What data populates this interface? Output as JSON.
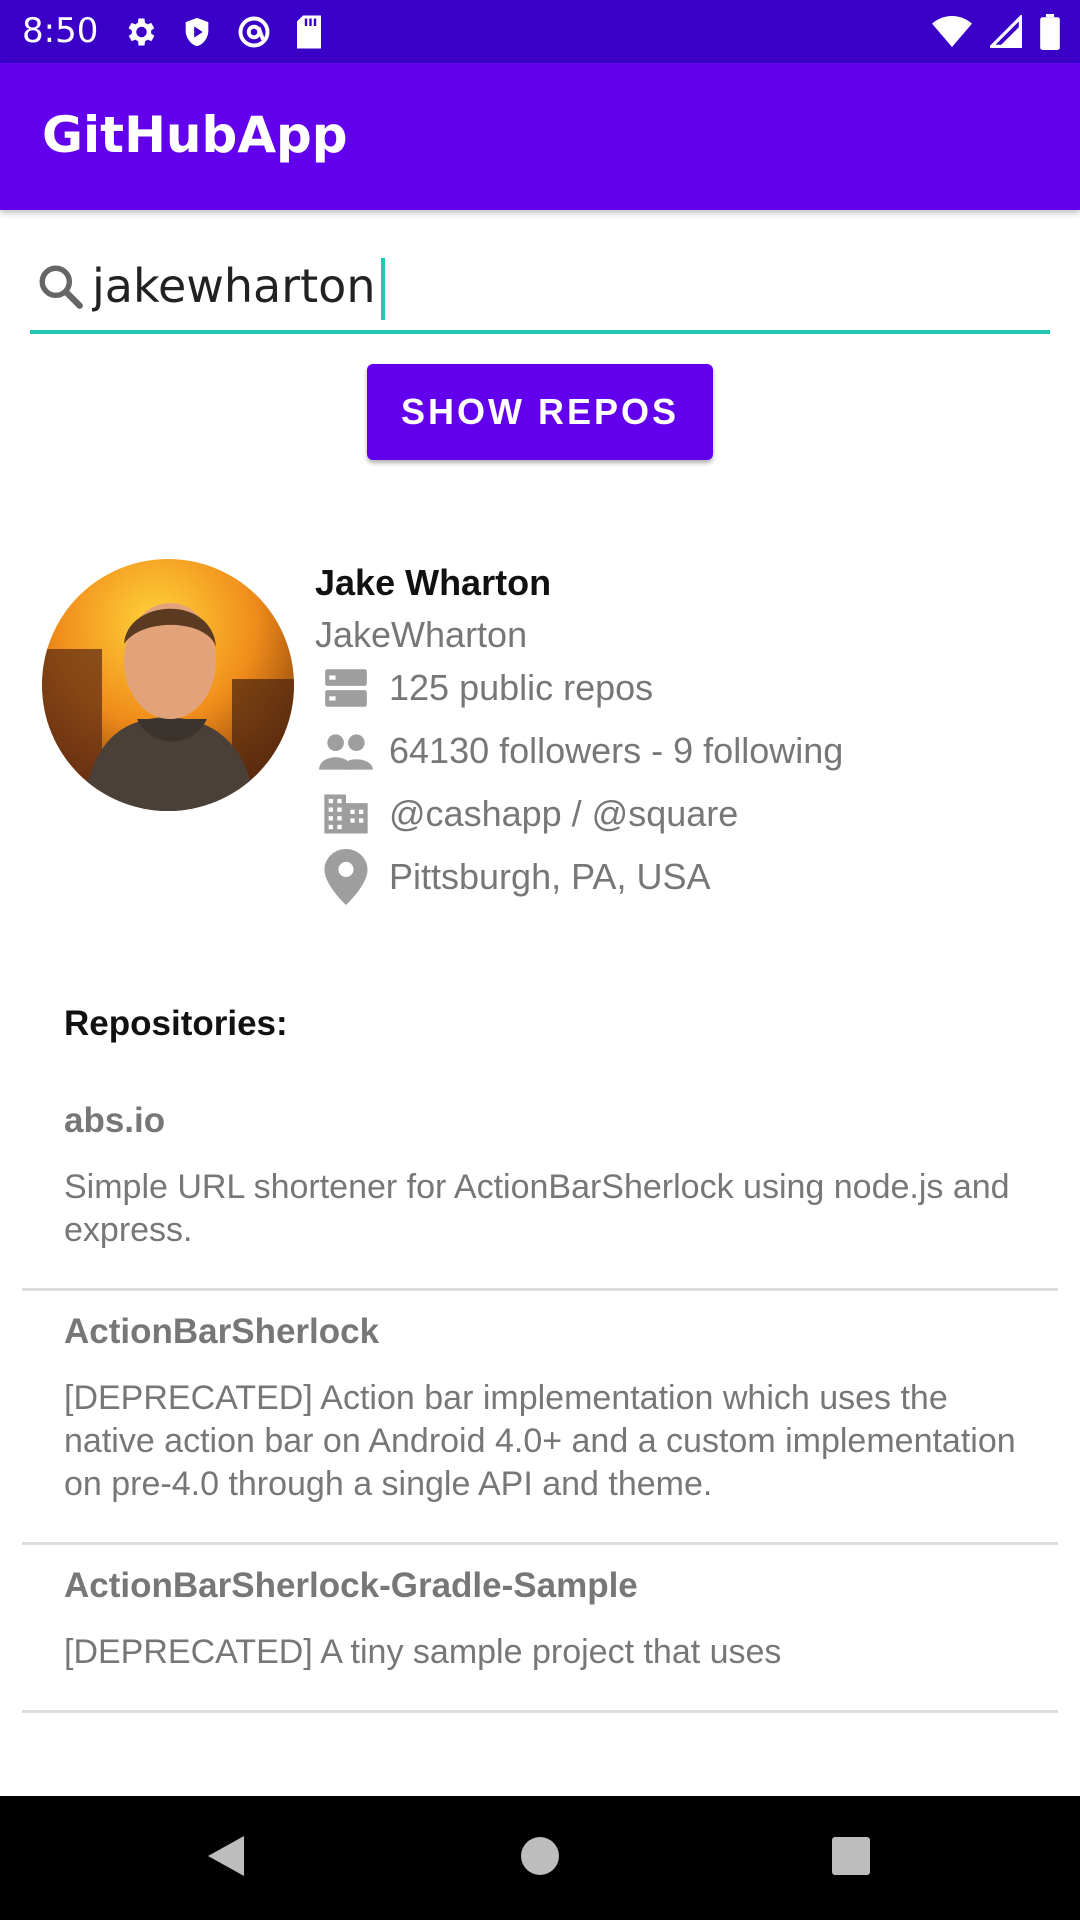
{
  "status_bar": {
    "time": "8:50",
    "left_icons": [
      "gear-icon",
      "play-protect-icon",
      "at-sign-icon",
      "sd-card-icon"
    ],
    "right_icons": [
      "wifi-icon",
      "signal-icon",
      "battery-icon"
    ]
  },
  "app_bar": {
    "title": "GitHubApp"
  },
  "search": {
    "value": "jakewharton",
    "placeholder": ""
  },
  "show_button": {
    "label": "SHOW REPOS"
  },
  "profile": {
    "name": "Jake Wharton",
    "login": "JakeWharton",
    "repos": "125 public repos",
    "followers": "64130 followers - 9 following",
    "company": "@cashapp / @square",
    "location": "Pittsburgh, PA, USA"
  },
  "repos_header": "Repositories:",
  "repos": [
    {
      "name": "abs.io",
      "description": "Simple URL shortener for ActionBarSherlock using node.js and express."
    },
    {
      "name": "ActionBarSherlock",
      "description": "[DEPRECATED] Action bar implementation which uses the native action bar on Android 4.0+ and a custom implementation on pre-4.0 through a single API and theme."
    },
    {
      "name": "ActionBarSherlock-Gradle-Sample",
      "description": "[DEPRECATED] A tiny sample project that uses"
    }
  ],
  "colors": {
    "primary": "#6200ee",
    "status": "#3a00c8",
    "accent": "#21c9b5"
  }
}
